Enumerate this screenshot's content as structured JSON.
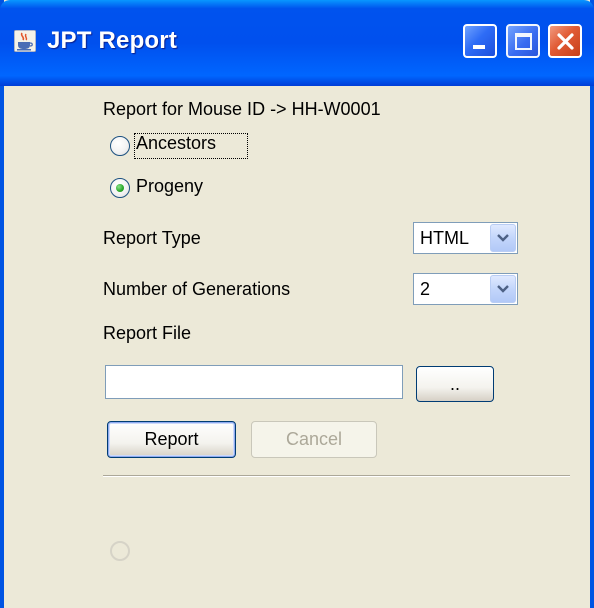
{
  "window": {
    "title": "JPT Report",
    "title_icon": "java-cup-icon",
    "controls": {
      "minimize": "minimize-icon",
      "maximize": "maximize-icon",
      "close": "close-icon"
    }
  },
  "report_for": "Report for Mouse ID -> HH-W0001",
  "direction": {
    "options": [
      {
        "label": "Ancestors",
        "selected": false
      },
      {
        "label": "Progeny",
        "selected": true
      }
    ]
  },
  "report_type": {
    "label": "Report Type",
    "value": "HTML"
  },
  "generations": {
    "label": "Number of Generations",
    "value": "2"
  },
  "report_file": {
    "label": "Report File",
    "value": "",
    "browse_label": ".."
  },
  "actions": {
    "report_label": "Report",
    "cancel_label": "Cancel"
  },
  "colors": {
    "titlebar": "#0054e3",
    "window_bg": "#ece9d8",
    "close_button": "#e15b35",
    "radio_selected": "#29a829"
  }
}
